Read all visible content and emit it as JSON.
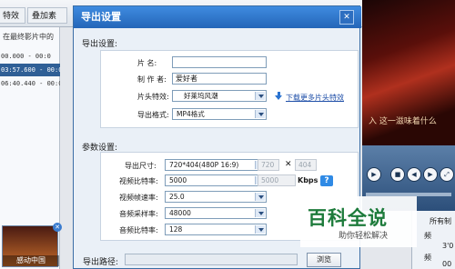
{
  "background": {
    "toolbar_tabs": [
      "特效",
      "叠加素材"
    ],
    "hint_text": "在最终影片中的",
    "timeline_rows": [
      {
        "text": "00.000 - 00:0",
        "selected": false
      },
      {
        "text": "03:57.600 - 00:0",
        "selected": true
      },
      {
        "text": "06:40.440 - 00:0",
        "selected": false
      }
    ],
    "thumbnail_caption": "感动中国",
    "preview_caption": "入 这一滋味着什么",
    "right_items": [
      "所有制",
      "频",
      "3'0",
      "频",
      "00"
    ]
  },
  "dialog": {
    "title": "导出设置",
    "close_glyph": "✕",
    "section_export": "导出设置:",
    "name_label": "片    名:",
    "name_value": "",
    "author_label": "制 作 者:",
    "author_value": "爱好者",
    "intro_label": "片头特效:",
    "intro_value": "好莱坞风潮",
    "download_link": "下载更多片头特效",
    "format_label": "导出格式:",
    "format_value": "MP4格式",
    "section_params": "参数设置:",
    "size_label": "导出尺寸:",
    "size_value": "720*404(480P 16:9)",
    "size_w": "720",
    "size_x": "✕",
    "size_h": "404",
    "vbitrate_label": "视频比特率:",
    "vbitrate_value": "5000",
    "vbitrate_disabled": "5000",
    "kbps": "Kbps",
    "help": "?",
    "fps_label": "视频帧速率:",
    "fps_value": "25.0",
    "asample_label": "音频采样率:",
    "asample_value": "48000",
    "abitrate_label": "音频比特率:",
    "abitrate_value": "128",
    "path_label": "导出路径:",
    "path_value": "",
    "browse_label": "浏览"
  },
  "watermark": {
    "title": "百科全说",
    "subtitle": "助你轻松解决"
  }
}
